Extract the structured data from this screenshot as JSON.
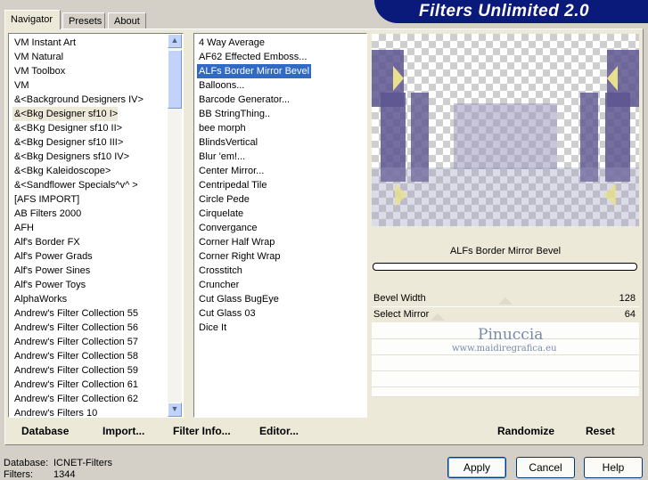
{
  "window": {
    "title": "Filters Unlimited 2.0"
  },
  "tabs": [
    {
      "label": "Navigator",
      "active": true
    },
    {
      "label": "Presets",
      "active": false
    },
    {
      "label": "About",
      "active": false
    }
  ],
  "categories": {
    "items": [
      "VM Instant Art",
      "VM Natural",
      "VM Toolbox",
      "VM",
      "&<Background Designers IV>",
      "&<Bkg Designer sf10 I>",
      "&<BKg Designer sf10 II>",
      "&<Bkg Designer sf10 III>",
      "&<Bkg Designers sf10 IV>",
      "&<Bkg Kaleidoscope>",
      "&<Sandflower Specials^v^ >",
      "[AFS IMPORT]",
      "AB Filters 2000",
      "AFH",
      "Alf's Border FX",
      "Alf's Power Grads",
      "Alf's Power Sines",
      "Alf's Power Toys",
      "AlphaWorks",
      "Andrew's Filter Collection 55",
      "Andrew's Filter Collection 56",
      "Andrew's Filter Collection 57",
      "Andrew's Filter Collection 58",
      "Andrew's Filter Collection 59",
      "Andrew's Filter Collection 61",
      "Andrew's Filter Collection 62",
      "Andrew's Filters 10"
    ],
    "selected_index": 5
  },
  "filters": {
    "items": [
      "4 Way Average",
      "AF62 Effected Emboss...",
      "ALFs Border Mirror Bevel",
      "Balloons...",
      "Barcode Generator...",
      "BB StringThing..",
      "bee morph",
      "BlindsVertical",
      "Blur 'em!...",
      "Center Mirror...",
      "Centripedal Tile",
      "Circle Pede",
      "Cirquelate",
      "Convergance",
      "Corner Half Wrap",
      "Corner Right Wrap",
      "Crosstitch",
      "Cruncher",
      "Cut Glass  BugEye",
      "Cut Glass 03",
      "Dice It"
    ],
    "selected_index": 2
  },
  "preview": {
    "filter_name": "ALFs Border Mirror Bevel",
    "progress": 0
  },
  "params": [
    {
      "label": "Bevel Width",
      "value": "128",
      "slider_fraction": 0.5
    },
    {
      "label": "Select Mirror",
      "value": "64",
      "slider_fraction": 0.25
    }
  ],
  "watermark": {
    "line1": "Pinuccia",
    "line2": "www.maidiregrafica.eu"
  },
  "toolbar": {
    "database": "Database",
    "import": "Import...",
    "filter_info": "Filter Info...",
    "editor": "Editor...",
    "randomize": "Randomize",
    "reset": "Reset"
  },
  "status": {
    "database_label": "Database:",
    "database_value": "ICNET-Filters",
    "filters_label": "Filters:",
    "filters_value": "1344"
  },
  "buttons": {
    "apply": "Apply",
    "cancel": "Cancel",
    "help": "Help"
  },
  "colors": {
    "selection": "#316ac5",
    "banner": "#0a1a7a",
    "preview_purple": "#5d5590",
    "preview_yellow": "#e8e08c"
  }
}
